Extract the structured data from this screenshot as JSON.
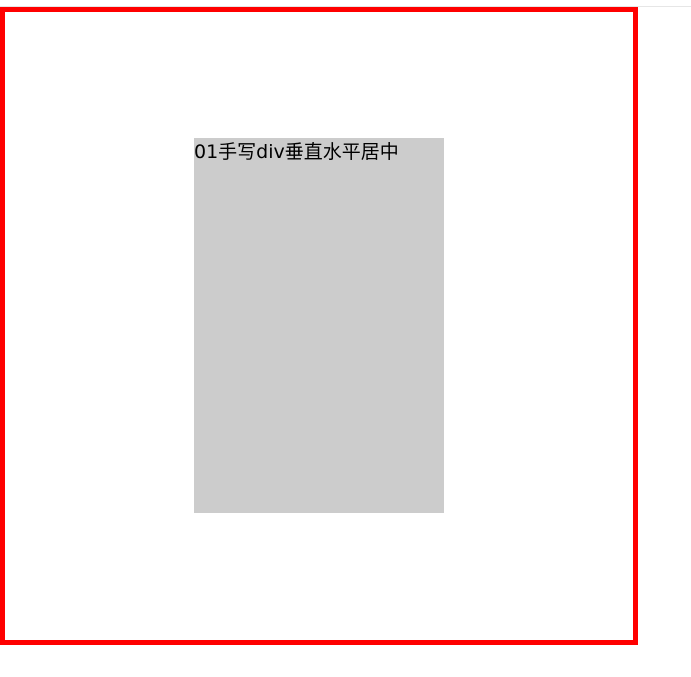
{
  "content": {
    "centered_label": "01手写div垂直水平居中"
  },
  "colors": {
    "outer_border": "#ff0000",
    "inner_fill": "#cccccc",
    "background": "#ffffff",
    "text": "#000000"
  }
}
